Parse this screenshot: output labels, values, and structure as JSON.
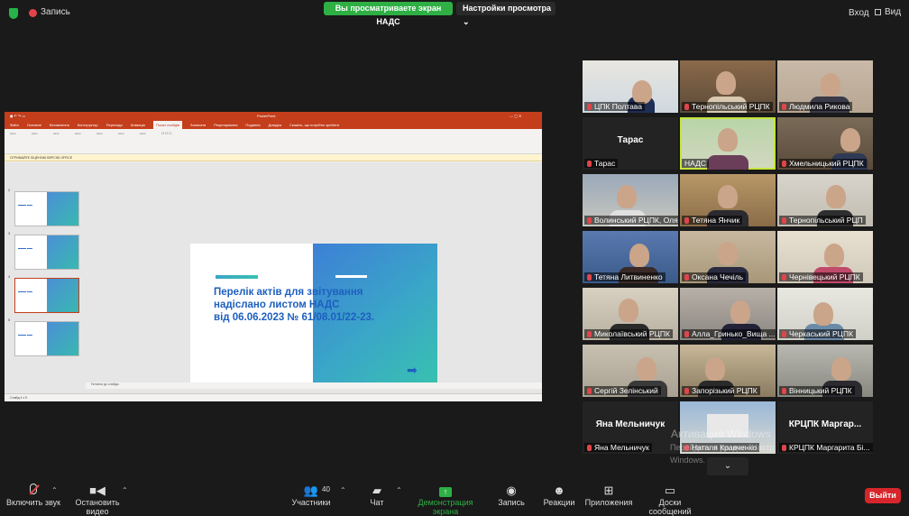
{
  "topbar": {
    "recording_label": "Запись",
    "viewing_badge": "Вы просматриваете экран НАДС",
    "view_settings": "Настройки просмотра",
    "login": "Вход",
    "view": "Вид"
  },
  "shared_screen": {
    "app_title": "PowerPoint",
    "tabs": [
      "Файл",
      "Основне",
      "Вставлення",
      "Конструктор",
      "Переходи",
      "Анімація",
      "Показ слайдів",
      "Записати",
      "Рецензування",
      "Подання",
      "Довідка",
      "Скажіть, що потрібно зробити"
    ],
    "active_tab": "Показ слайдів",
    "notice": "ОТРИМАЙТЕ ЛІЦЕНЗІЮ ВЕРСІЮ OFFICE",
    "slide_numbers": [
      "2",
      "3",
      "4",
      "5"
    ],
    "slide_title_lines": [
      "Перелік актів для звітування",
      "надіслано листом НАДС",
      "від 06.06.2023 № 61/08.01/22-23."
    ],
    "notes_placeholder": "Нотатки до слайда",
    "status": "Слайд 4 з 5"
  },
  "participants": [
    {
      "name": "ЦПК Полтава",
      "muted": true
    },
    {
      "name": "Тернопільський РЦПК",
      "muted": true
    },
    {
      "name": "Людмила Рикова",
      "muted": true
    },
    {
      "name": "Тарас",
      "muted": true,
      "display": "Тарас"
    },
    {
      "name": "НАДС",
      "muted": false
    },
    {
      "name": "Хмельницький РЦПК",
      "muted": true
    },
    {
      "name": "Волинський РЦПК, Оля...",
      "muted": true
    },
    {
      "name": "Тетяна Янчик",
      "muted": true
    },
    {
      "name": "Тернопільський РЦП",
      "muted": true
    },
    {
      "name": "Тетяна Литвиненко",
      "muted": true
    },
    {
      "name": "Оксана Чечіль",
      "muted": true
    },
    {
      "name": "Чернівецький РЦПК",
      "muted": true
    },
    {
      "name": "Миколаївський РЦПК",
      "muted": true
    },
    {
      "name": "Алла_Гринько_Вища ...",
      "muted": true
    },
    {
      "name": "Черкаський РЦПК",
      "muted": true
    },
    {
      "name": "Сергій Зелінський",
      "muted": true
    },
    {
      "name": "Запорізький РЦПК",
      "muted": true
    },
    {
      "name": "Вінницький РЦПК",
      "muted": true
    },
    {
      "name": "Яна Мельничук",
      "muted": true,
      "display": "Яна Мельничук"
    },
    {
      "name": "Наталя Кравченко",
      "muted": true
    },
    {
      "name": "КРЦПК Маргарита Бі...",
      "muted": true,
      "display": "КРЦПК Маргар..."
    }
  ],
  "watermark": {
    "line1": "Активация Windows",
    "line2": "Перейдите в раздел \"Настр",
    "line3": "Windows."
  },
  "toolbar": {
    "unmute": "Включить звук",
    "start_video": "Остановить видео",
    "participants": "Участники",
    "participants_count": "40",
    "chat": "Чат",
    "share": "Демонстрация экрана",
    "record": "Запись",
    "reactions": "Реакции",
    "apps": "Приложения",
    "whiteboards": "Доски сообщений",
    "leave": "Выйти"
  },
  "colors": {
    "accent_green": "#2eb045",
    "leave_red": "#d6262b",
    "powerpoint": "#c43e1c",
    "active_speaker": "#c5e63a"
  }
}
